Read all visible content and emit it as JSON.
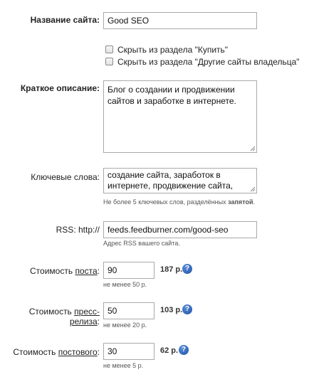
{
  "site_name": {
    "label": "Название сайта:",
    "value": "Good SEO"
  },
  "visibility": {
    "hide_buy": {
      "label": "Скрыть из раздела \"Купить\"",
      "checked": false
    },
    "hide_other": {
      "label": "Скрыть из раздела \"Другие сайты владельца\"",
      "checked": false
    }
  },
  "description": {
    "label": "Краткое описание:",
    "value": "Блог о создании и продвижении сайтов и заработке в интернете."
  },
  "keywords": {
    "label": "Ключевые слова:",
    "value": "создание сайта, заработок в интернете, продвижение сайта, монетизация, seo",
    "hint_text": "Не более 5 ключевых слов, разделённых ",
    "hint_bold": "запятой",
    "hint_end": "."
  },
  "rss": {
    "label": "RSS: http://",
    "value": "feeds.feedburner.com/good-seo",
    "hint": "Адрес RSS вашего сайта."
  },
  "post_cost": {
    "label_prefix": "Стоимость ",
    "label_link": "поста",
    "label_suffix": ":",
    "value": "90",
    "price": "187 р.",
    "hint": "не менее 50 р."
  },
  "press_cost": {
    "label_prefix": "Стоимость ",
    "label_link": "пресс-релиза",
    "label_suffix": ":",
    "value": "50",
    "price": "103 р.",
    "hint": "не менее 20 р."
  },
  "permanent_cost": {
    "label_prefix": "Стоимость ",
    "label_link": "постового",
    "label_suffix": ":",
    "value": "30",
    "price": "62 р.",
    "hint": "не менее 5 р."
  },
  "help_icon": {
    "glyph": "?",
    "color": "#1f4fa6"
  }
}
